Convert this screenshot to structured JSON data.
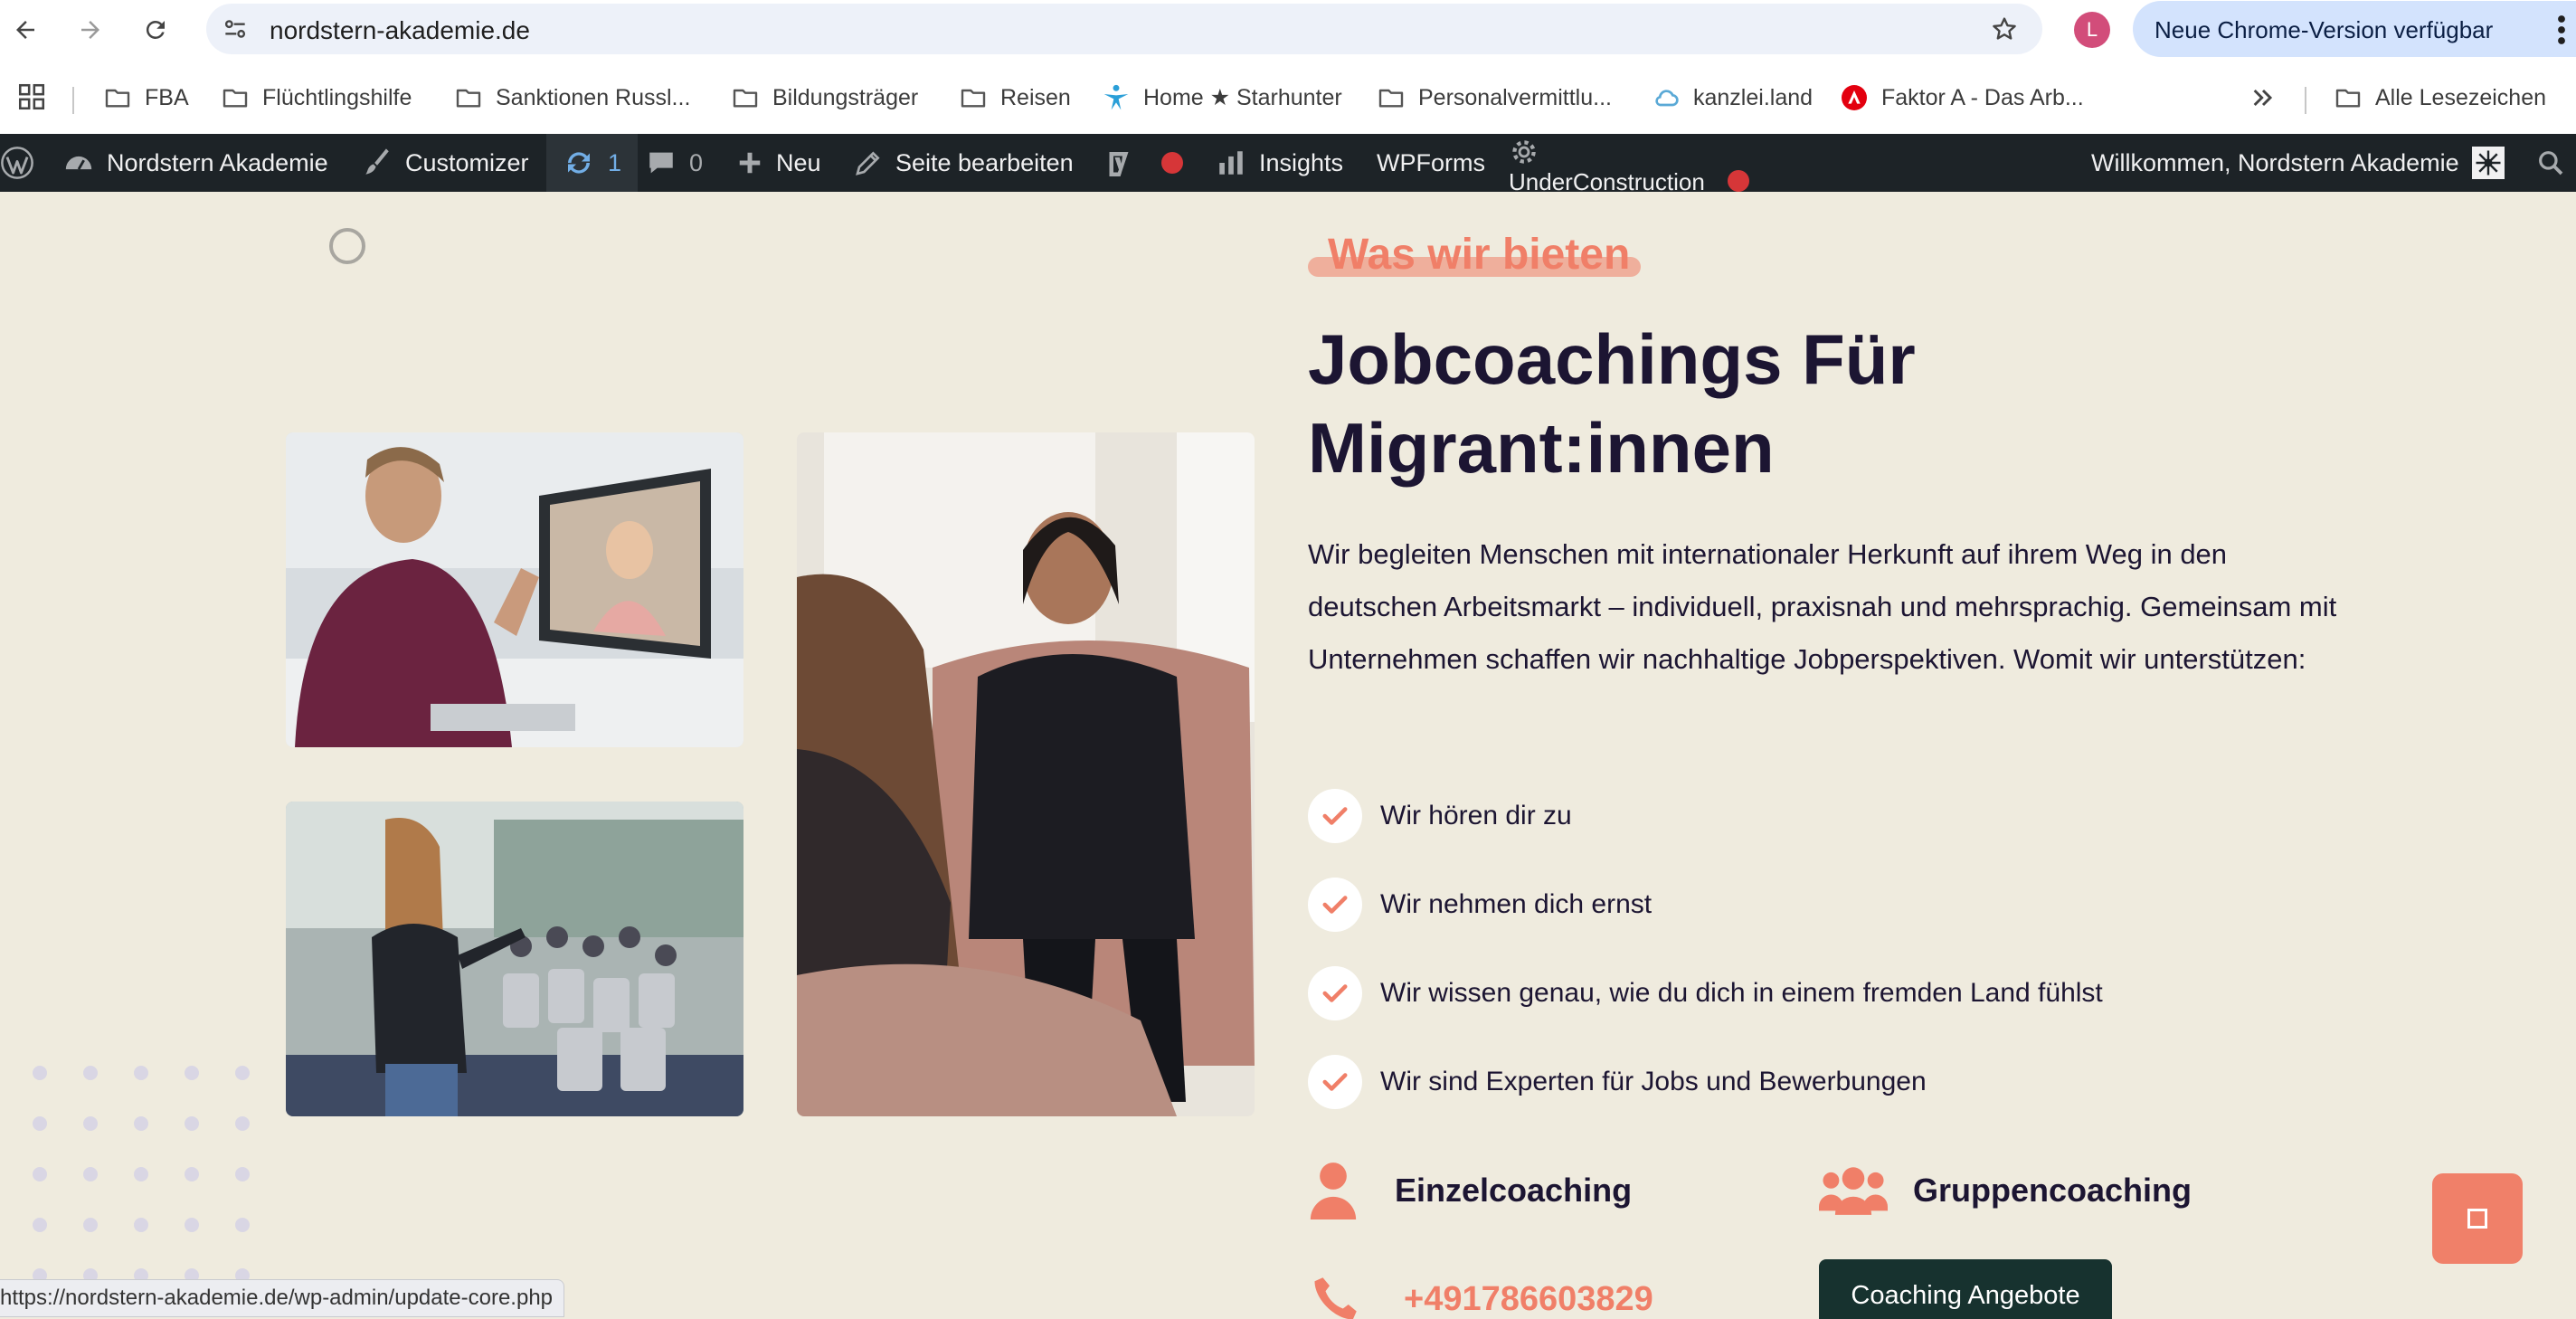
{
  "browser": {
    "url": "nordstern-akademie.de",
    "profile_initial": "L",
    "update_label": "Neue Chrome-Version verfügbar",
    "status_url": "https://nordstern-akademie.de/wp-admin/update-core.php"
  },
  "bookmarks": {
    "items": [
      {
        "label": "FBA",
        "icon": "folder-icon"
      },
      {
        "label": "Flüchtlingshilfe",
        "icon": "folder-icon"
      },
      {
        "label": "Sanktionen Russl...",
        "icon": "folder-icon"
      },
      {
        "label": "Bildungsträger",
        "icon": "folder-icon"
      },
      {
        "label": "Reisen",
        "icon": "folder-icon"
      },
      {
        "label": "Home ★ Starhunter",
        "icon": "starhunter-icon"
      },
      {
        "label": "Personalvermittlu...",
        "icon": "folder-icon"
      },
      {
        "label": "kanzlei.land",
        "icon": "cloud-icon"
      },
      {
        "label": "Faktor A - Das Arb...",
        "icon": "arbeitsagentur-icon"
      }
    ],
    "all_label": "Alle Lesezeichen"
  },
  "admin_bar": {
    "site_name": "Nordstern Akademie",
    "customizer": "Customizer",
    "updates_count": "1",
    "comments_count": "0",
    "new_label": "Neu",
    "edit_label": "Seite bearbeiten",
    "insights": "Insights",
    "wpforms": "WPForms",
    "under_construction": "UnderConstruction",
    "welcome": "Willkommen, Nordstern Akademie"
  },
  "section": {
    "eyebrow": "Was wir bieten",
    "heading": "Jobcoachings Für Migrant:innen",
    "intro": "Wir begleiten Menschen mit internationaler Herkunft auf ihrem Weg in den deutschen Arbeitsmarkt – individuell, praxisnah und mehrsprachig. Gemeinsam mit Unternehmen schaffen wir nachhaltige Jobperspektiven. Womit wir unterstützen:",
    "checklist": [
      "Wir hören dir zu",
      "Wir nehmen dich ernst",
      "Wir wissen genau, wie du dich in einem fremden Land fühlst",
      "Wir sind Experten für Jobs und Bewerbungen"
    ],
    "coaching": [
      "Einzelcoaching",
      "Gruppencoaching"
    ],
    "phone": "+491786603829",
    "cta": "Coaching Angebote"
  },
  "colors": {
    "accent": "#f07f68",
    "heading": "#1c1532",
    "background": "#efebde",
    "admin_bar": "#1d2327",
    "cta": "#17322f"
  }
}
